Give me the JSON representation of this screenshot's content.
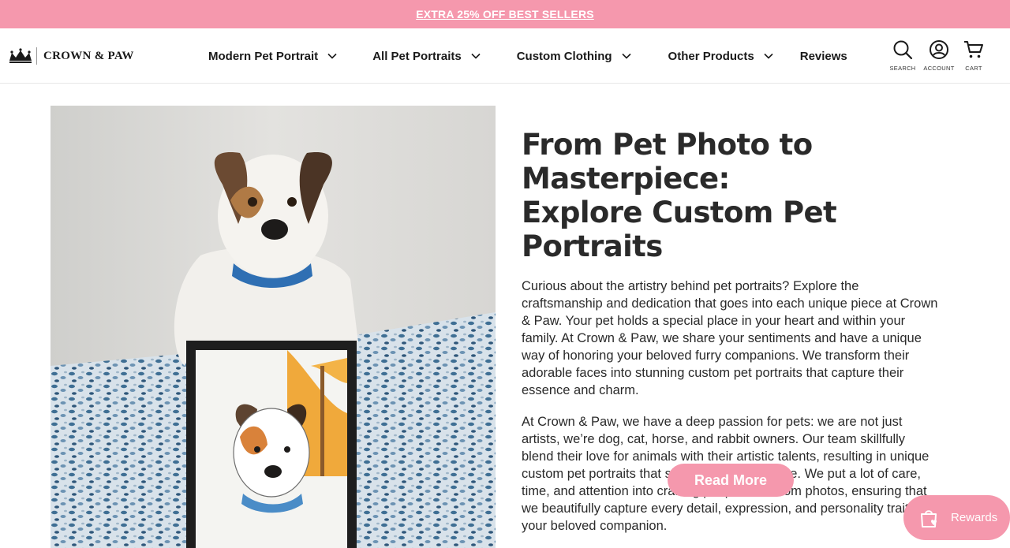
{
  "promo": {
    "text": "EXTRA 25% OFF BEST SELLERS"
  },
  "brand": {
    "name": "CROWN & PAW"
  },
  "nav": {
    "items": [
      {
        "label": "Modern Pet Portrait",
        "has_dropdown": true
      },
      {
        "label": "All Pet Portraits",
        "has_dropdown": true
      },
      {
        "label": "Custom Clothing",
        "has_dropdown": true
      },
      {
        "label": "Other Products",
        "has_dropdown": true
      },
      {
        "label": "Reviews",
        "has_dropdown": false
      }
    ]
  },
  "utility": {
    "search": "SEARCH",
    "account": "ACCOUNT",
    "cart": "CART"
  },
  "hero": {
    "headline_line1": "From Pet Photo to Masterpiece:",
    "headline_line2": "Explore Custom Pet Portraits",
    "paragraph1": "Curious about the artistry behind pet portraits? Explore the craftsmanship and dedication that goes into each unique piece at Crown & Paw. Your pet holds a special place in your heart and within your family. At Crown & Paw, we share your sentiments and have a unique way of honoring your beloved furry companions. We transform their adorable faces into stunning custom pet portraits that capture their essence and charm.",
    "paragraph2": "At Crown & Paw, we have a deep passion for pets: we are not just artists, we’re dog, cat, horse, and rabbit owners. Our team skillfully blend their love for animals with their artistic talents, resulting in unique custom pet portraits that stand out in your home. We put a lot of care, time, and attention into crafting pet portraits from photos, ensuring that we beautifully capture every detail, expression, and personality trait of your beloved companion.",
    "cta": "Read More"
  },
  "rewards": {
    "label": "Rewards"
  },
  "colors": {
    "accent": "#f598ad",
    "text": "#2a2a2a"
  },
  "icons": [
    "search-icon",
    "account-icon",
    "cart-icon",
    "chevron-down-icon",
    "crown-icon",
    "rewards-bag-icon"
  ]
}
